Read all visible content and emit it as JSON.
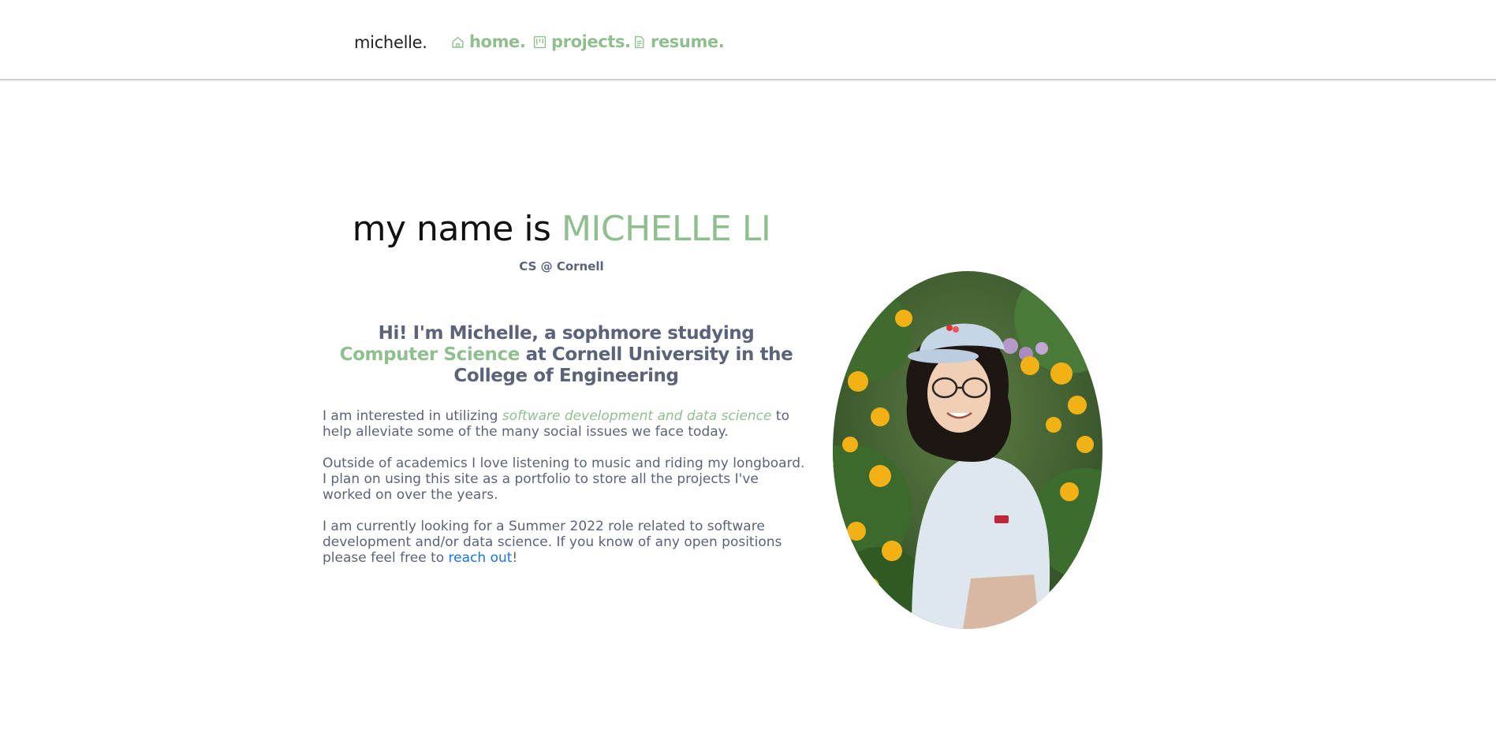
{
  "nav": {
    "brand": "michelle.",
    "home": "home.",
    "projects": "projects.",
    "resume": "resume."
  },
  "hero": {
    "title_prefix": "my name is ",
    "title_name": "MICHELLE LI",
    "subtitle": "CS @ Cornell"
  },
  "intro": {
    "heading_part1": "Hi! I'm Michelle, a sophmore studying ",
    "heading_accent": "Computer Science",
    "heading_part2": " at Cornell University in the College of Engineering"
  },
  "paragraphs": {
    "p1_before": "I am interested in utilizing ",
    "p1_accent": "software development and data science",
    "p1_after": " to help alleviate some of the many social issues we face today.",
    "p2": "Outside of academics I love listening to music and riding my longboard. I plan on using this site as a portfolio to store all the projects I've worked on over the years.",
    "p3_before": "I am currently looking for a Summer 2022 role related to software development and/or data science. If you know of any open positions please feel free to ",
    "p3_link": "reach out",
    "p3_after": "!"
  },
  "colors": {
    "accent": "#8fbf8f",
    "text": "#5c6378",
    "link": "#1a73e8"
  },
  "icons": {
    "home": "home-icon",
    "projects": "kanban-icon",
    "resume": "document-icon"
  }
}
